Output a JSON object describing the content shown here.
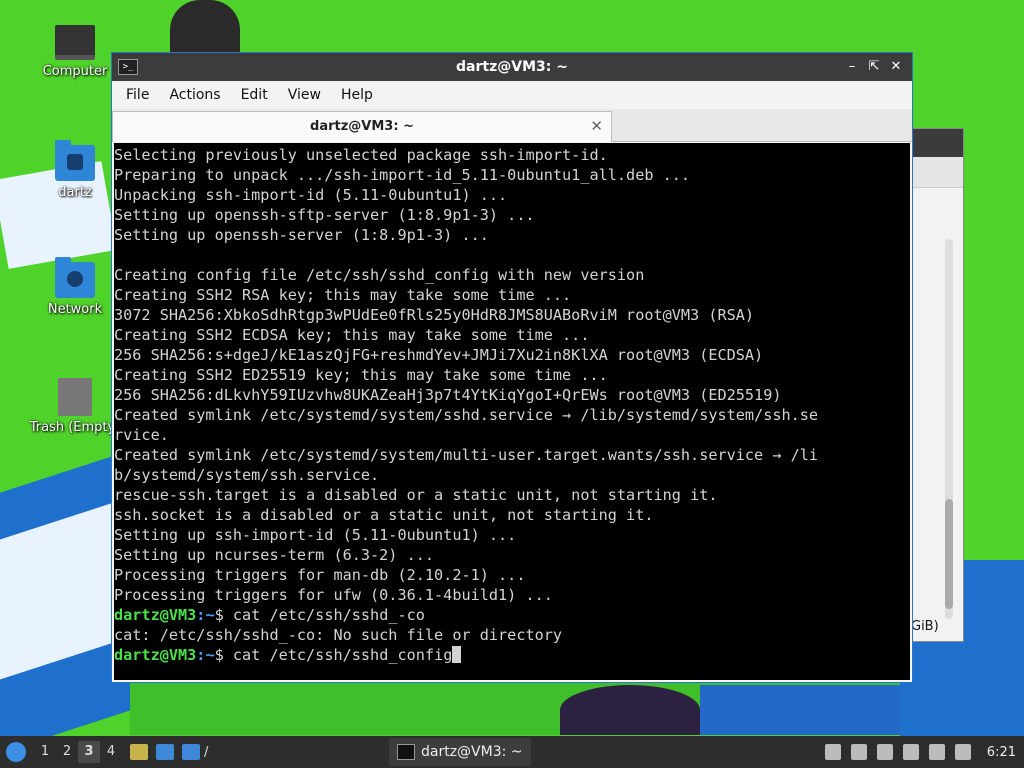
{
  "desktop": {
    "icons": [
      {
        "label": "Computer"
      },
      {
        "label": "dartz"
      },
      {
        "label": "Network"
      },
      {
        "label": "Trash (Empty)"
      }
    ]
  },
  "background_window": {
    "partial_text": "GiB)"
  },
  "terminal": {
    "window_title": "dartz@VM3: ~",
    "menu": [
      "File",
      "Actions",
      "Edit",
      "View",
      "Help"
    ],
    "tab_title": "dartz@VM3: ~",
    "output_lines": [
      "Selecting previously unselected package ssh-import-id.",
      "Preparing to unpack .../ssh-import-id_5.11-0ubuntu1_all.deb ...",
      "Unpacking ssh-import-id (5.11-0ubuntu1) ...",
      "Setting up openssh-sftp-server (1:8.9p1-3) ...",
      "Setting up openssh-server (1:8.9p1-3) ...",
      "",
      "Creating config file /etc/ssh/sshd_config with new version",
      "Creating SSH2 RSA key; this may take some time ...",
      "3072 SHA256:XbkoSdhRtgp3wPUdEe0fRls25y0HdR8JMS8UABoRviM root@VM3 (RSA)",
      "Creating SSH2 ECDSA key; this may take some time ...",
      "256 SHA256:s+dgeJ/kE1aszQjFG+reshmdYev+JMJi7Xu2in8KlXA root@VM3 (ECDSA)",
      "Creating SSH2 ED25519 key; this may take some time ...",
      "256 SHA256:dLkvhY59IUzvhw8UKAZeaHj3p7t4YtKiqYgoI+QrEWs root@VM3 (ED25519)",
      "Created symlink /etc/systemd/system/sshd.service → /lib/systemd/system/ssh.se",
      "rvice.",
      "Created symlink /etc/systemd/system/multi-user.target.wants/ssh.service → /li",
      "b/systemd/system/ssh.service.",
      "rescue-ssh.target is a disabled or a static unit, not starting it.",
      "ssh.socket is a disabled or a static unit, not starting it.",
      "Setting up ssh-import-id (5.11-0ubuntu1) ...",
      "Setting up ncurses-term (6.3-2) ...",
      "Processing triggers for man-db (2.10.2-1) ...",
      "Processing triggers for ufw (0.36.1-4build1) ..."
    ],
    "prompt_user": "dartz@VM3",
    "prompt_path": ":~",
    "prompt_symbol": "$",
    "command1": " cat /etc/ssh/sshd_-co",
    "error_line": "cat: /etc/ssh/sshd_-co: No such file or directory",
    "command2": " cat /etc/ssh/sshd_config"
  },
  "taskbar": {
    "workspaces": [
      "1",
      "2",
      "3",
      "4"
    ],
    "active_workspace": "3",
    "path_separator": "/",
    "task_label": "dartz@VM3: ~",
    "clock": "6:21"
  },
  "colors": {
    "prompt_user": "#4ce04c",
    "prompt_path": "#4aa0ff",
    "terminal_bg": "#000000",
    "terminal_fg": "#d3d3d3"
  }
}
